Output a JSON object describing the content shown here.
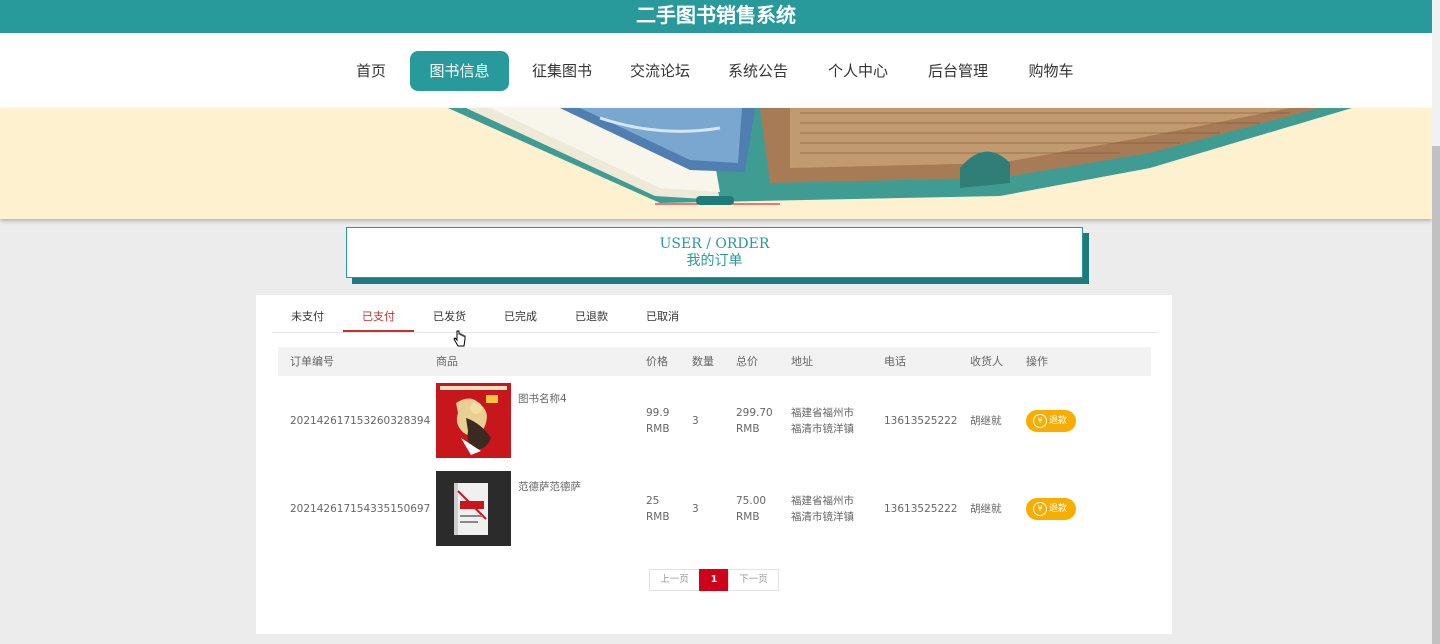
{
  "site": {
    "title": "二手图书销售系统"
  },
  "nav": {
    "items": [
      {
        "label": "首页"
      },
      {
        "label": "图书信息",
        "active": true
      },
      {
        "label": "征集图书"
      },
      {
        "label": "交流论坛"
      },
      {
        "label": "系统公告"
      },
      {
        "label": "个人中心"
      },
      {
        "label": "后台管理"
      },
      {
        "label": "购物车"
      }
    ]
  },
  "section": {
    "title_en": "USER / ORDER",
    "title_cn": "我的订单"
  },
  "tabs": [
    {
      "label": "未支付"
    },
    {
      "label": "已支付",
      "active": true
    },
    {
      "label": "已发货"
    },
    {
      "label": "已完成"
    },
    {
      "label": "已退款"
    },
    {
      "label": "已取消"
    }
  ],
  "table": {
    "headers": [
      "订单编号",
      "商品",
      "价格",
      "数量",
      "总价",
      "地址",
      "电话",
      "收货人",
      "操作"
    ],
    "rows": [
      {
        "order_no": "202142617153260328394",
        "product": "图书名称4",
        "price": "99.9",
        "price_unit": "RMB",
        "qty": "3",
        "total": "299.70",
        "total_unit": "RMB",
        "addr1": "福建省福州市",
        "addr2": "福清市镜洋镇",
        "phone": "13613525222",
        "receiver": "胡继就",
        "action": "退款"
      },
      {
        "order_no": "202142617154335150697",
        "product": "范德萨范德萨",
        "price": "25",
        "price_unit": "RMB",
        "qty": "3",
        "total": "75.00",
        "total_unit": "RMB",
        "addr1": "福建省福州市",
        "addr2": "福清市镜洋镇",
        "phone": "13613525222",
        "receiver": "胡继就",
        "action": "退款"
      }
    ]
  },
  "pager": {
    "prev": "上一页",
    "current": "1",
    "next": "下一页"
  },
  "colors": {
    "primary": "#299a9b",
    "accent_red": "#c9302c",
    "refund": "#f7ae00",
    "banner_bg": "#fdf1cf"
  },
  "icons": {
    "refund": "yen-icon",
    "cursor": "hand-cursor-icon"
  }
}
